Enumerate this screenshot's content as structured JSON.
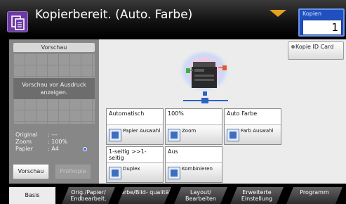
{
  "header": {
    "status_title": "Kopierbereit. (Auto. Farbe)",
    "copies_label": "Kopien",
    "copies_value": "1"
  },
  "preview": {
    "title": "Vorschau",
    "message": "Vorschau vor Ausdruck anzeigen.",
    "info": [
      {
        "key": "Original",
        "value": ": ---"
      },
      {
        "key": "Zoom",
        "value": ": 100%"
      },
      {
        "key": "Papier",
        "value": ": A4"
      }
    ],
    "vorschau_button": "Vorschau",
    "pruefkopie_button": "Prüfkopie"
  },
  "id_card_button": "Kopie ID Card",
  "function_keys": [
    {
      "value": "Automatisch",
      "label": "Papier Auswahl",
      "icon": "paper-select-icon"
    },
    {
      "value": "100%",
      "label": "Zoom",
      "icon": "zoom-icon"
    },
    {
      "value": "Auto Farbe",
      "label": "Farb Auswahl",
      "icon": "color-select-icon"
    },
    {
      "value": "1-seitig >>1-seitig",
      "label": "Duplex",
      "icon": "duplex-icon"
    },
    {
      "value": "Aus",
      "label": "Kombinieren",
      "icon": "combine-icon"
    }
  ],
  "tabs": [
    {
      "label": "Basis",
      "active": true
    },
    {
      "label": "Orig./Papier/ Endbearbeit.",
      "active": false
    },
    {
      "label": "Farbe/Bild- qualität",
      "active": false
    },
    {
      "label": "Layout/ Bearbeiten",
      "active": false
    },
    {
      "label": "Erweiterte Einstellung",
      "active": false
    },
    {
      "label": "Programm",
      "active": false
    }
  ],
  "colors": {
    "copy_icon": "#6c3aa3",
    "copies_box": "#2050c0",
    "notify": "#e8a020"
  }
}
